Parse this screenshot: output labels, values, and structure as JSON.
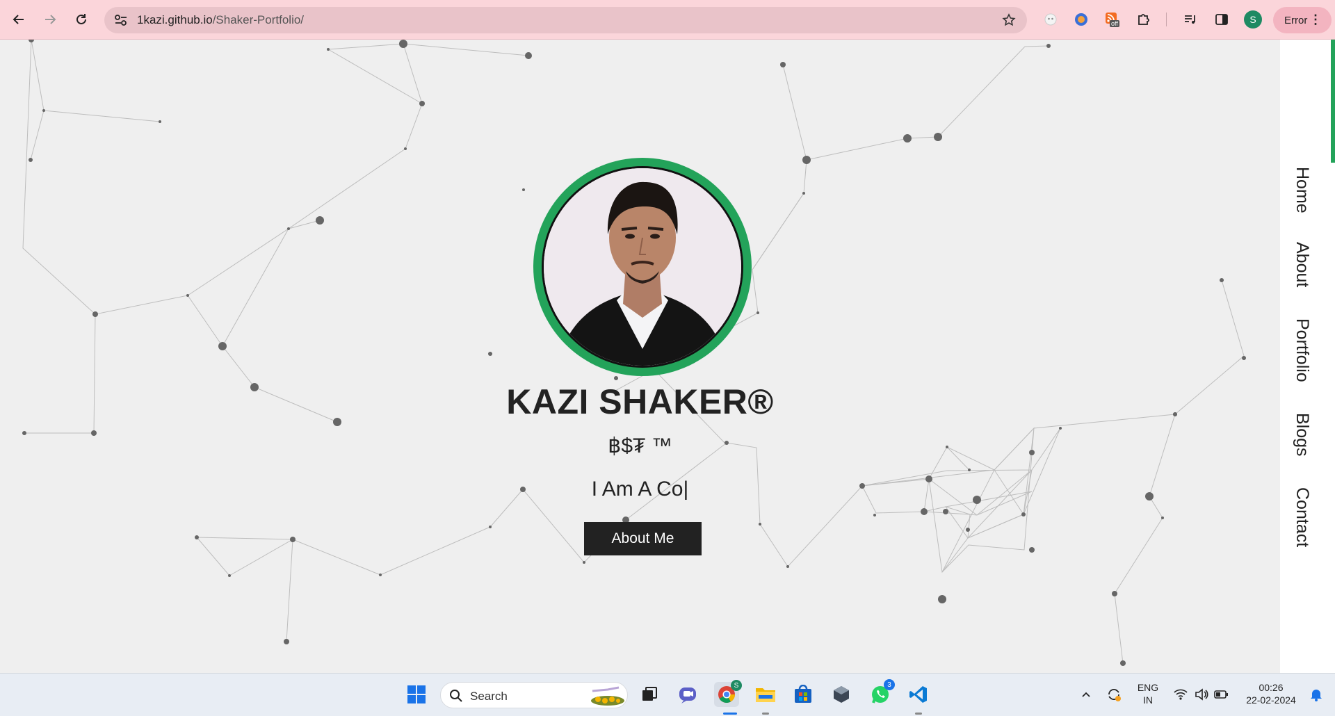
{
  "browser": {
    "url_host": "1kazi.github.io",
    "url_path": "/Shaker-Portfolio/",
    "extensions": [
      "ghost-extension-icon",
      "color-picker-extension-icon",
      "rss-off-extension-icon",
      "puzzle-icon"
    ],
    "extension_badge": "off",
    "profile_initial": "S",
    "error_label": "Error"
  },
  "hero": {
    "name": "KAZI SHAKER®",
    "tagline": "฿$₮ ™",
    "typing_text": "I Am A Co|",
    "cta_label": "About Me",
    "accent_color": "#23a35a"
  },
  "sidenav": {
    "items": [
      {
        "label": "Home"
      },
      {
        "label": "About"
      },
      {
        "label": "Portfolio"
      },
      {
        "label": "Blogs"
      },
      {
        "label": "Contact"
      }
    ]
  },
  "taskbar": {
    "search_placeholder": "Search",
    "whatsapp_badge": "3",
    "chrome_badge": "S",
    "language": "ENG",
    "region": "IN",
    "time": "00:26",
    "date": "22-02-2024"
  }
}
